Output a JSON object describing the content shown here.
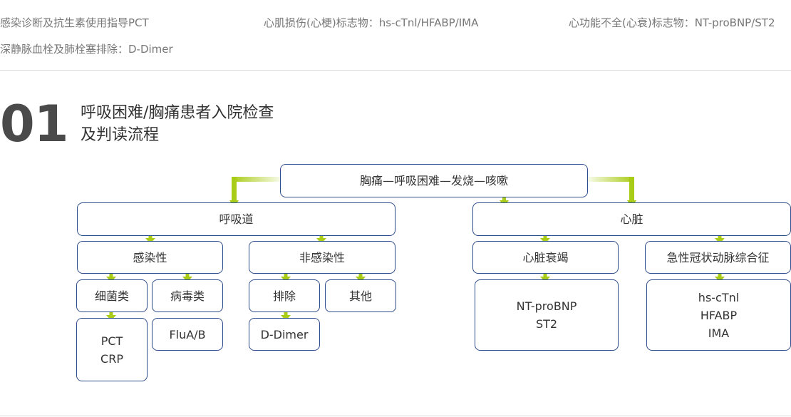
{
  "top_links": [
    "感染诊断及抗生素使用指导PCT",
    "心肌损伤(心梗)标志物：hs-cTnl/HFABP/IMA",
    "心功能不全(心衰)标志物：NT-proBNP/ST2",
    "深静脉血栓及肺栓塞排除：D-Dimer"
  ],
  "section": {
    "number": "01",
    "title_line1": "呼吸困难/胸痛患者入院检查",
    "title_line2": "及判读流程"
  },
  "flowchart": {
    "root": "胸痛—呼吸困难—发烧—咳嗽",
    "respiratory": "呼吸道",
    "heart": "心脏",
    "infectious": "感染性",
    "non_infectious": "非感染性",
    "heart_failure": "心脏衰竭",
    "acs": "急性冠状动脉综合征",
    "bacterial": "细菌类",
    "viral": "病毒类",
    "exclusion": "排除",
    "other": "其他",
    "bacterial_markers": [
      "PCT",
      "CRP"
    ],
    "viral_markers": [
      "FluA/B"
    ],
    "exclusion_markers": [
      "D-Dimer"
    ],
    "heart_failure_markers": [
      "NT-proBNP",
      "ST2"
    ],
    "acs_markers": [
      "hs-cTnl",
      "HFABP",
      "IMA"
    ]
  },
  "colors": {
    "connector": "#a9cc17",
    "node_border": "#2e4d8c",
    "divider": "#d9d9d9",
    "nav_text": "#777777"
  }
}
